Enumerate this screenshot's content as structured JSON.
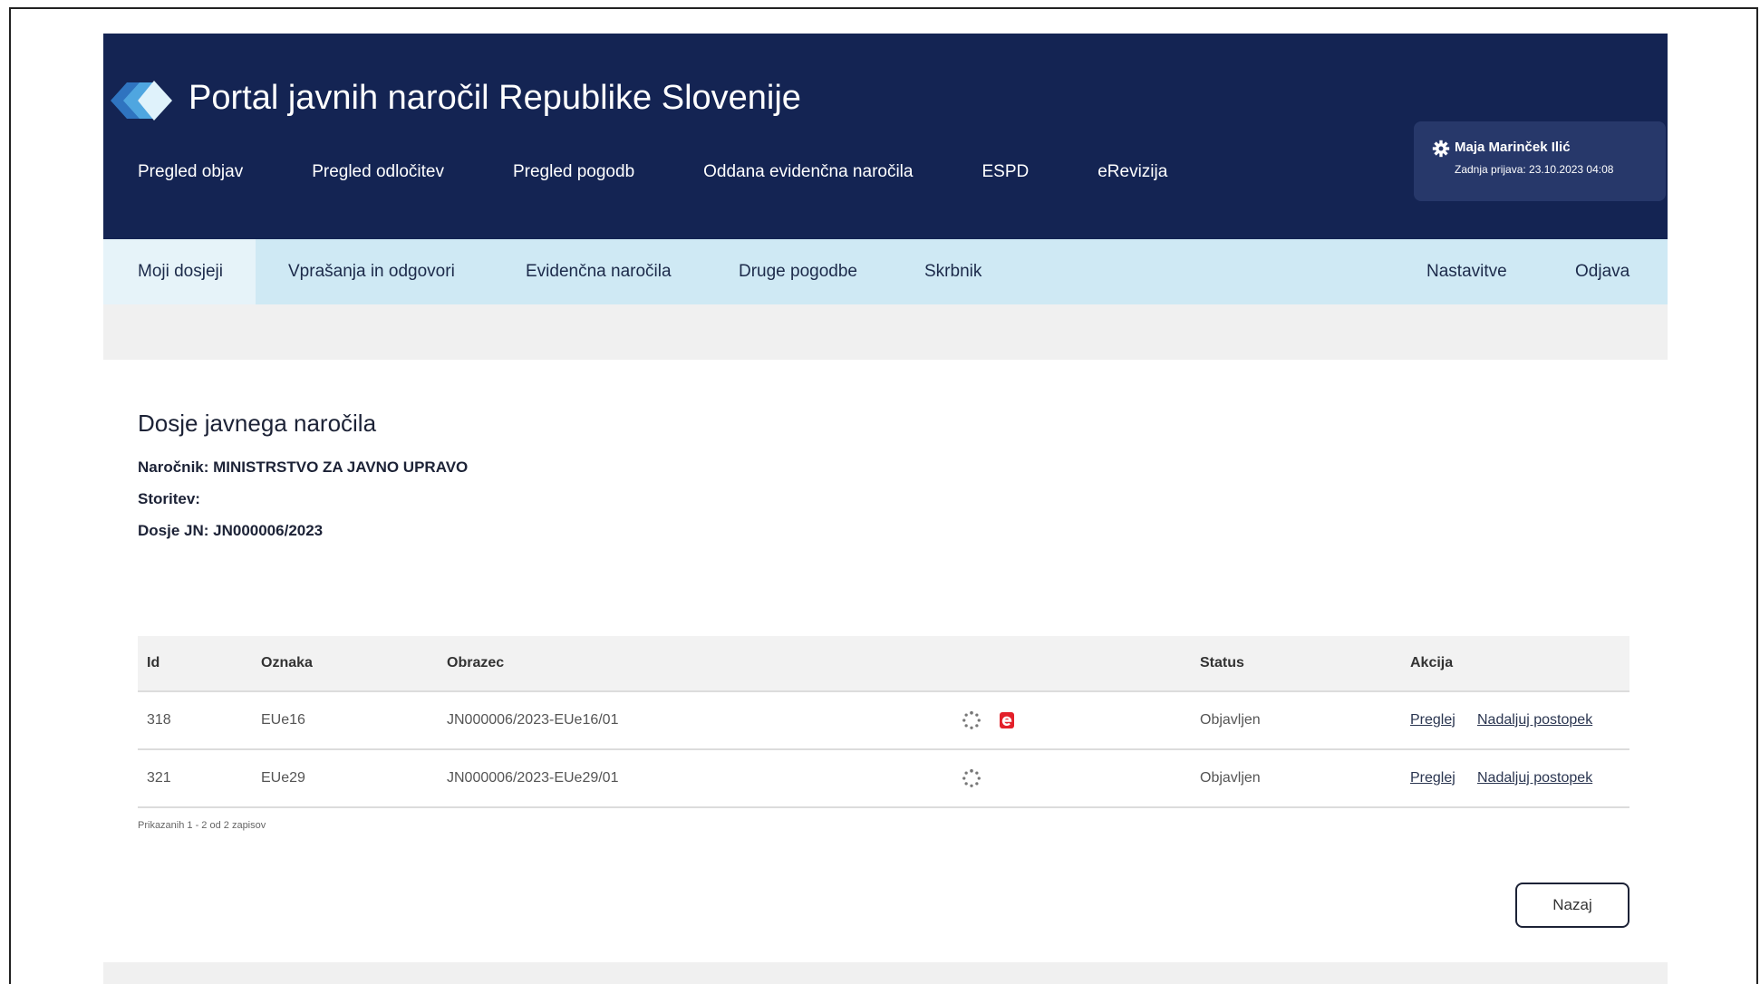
{
  "header": {
    "title": "Portal javnih naročil Republike Slovenije",
    "nav": [
      "Pregled objav",
      "Pregled odločitev",
      "Pregled pogodb",
      "Oddana evidenčna naročila",
      "ESPD",
      "eRevizija"
    ],
    "user": {
      "name": "Maja Marinček Ilić",
      "last_login": "Zadnja prijava: 23.10.2023 04:08",
      "icon": "gear-icon"
    }
  },
  "subnav": {
    "items": [
      "Moji dosjeji",
      "Vprašanja in odgovori",
      "Evidenčna naročila",
      "Druge pogodbe",
      "Skrbnik"
    ],
    "active": "Moji dosjeji",
    "right": [
      "Nastavitve",
      "Odjava"
    ]
  },
  "dossier": {
    "title": "Dosje javnega naročila",
    "narocnik": "Naročnik: MINISTRSTVO ZA JAVNO UPRAVO",
    "storitev": "Storitev:",
    "dosje": "Dosje JN: JN000006/2023"
  },
  "table": {
    "headers": {
      "id": "Id",
      "oznaka": "Oznaka",
      "obrazec": "Obrazec",
      "status": "Status",
      "akcija": "Akcija"
    },
    "rows": [
      {
        "id": "318",
        "oznaka": "EUe16",
        "obrazec": "JN000006/2023-EUe16/01",
        "status": "Objavljen",
        "view": "Preglej",
        "continue": "Nadaljuj postopek",
        "icons": [
          "spinner-icon",
          "e-icon"
        ]
      },
      {
        "id": "321",
        "oznaka": "EUe29",
        "obrazec": "JN000006/2023-EUe29/01",
        "status": "Objavljen",
        "view": "Preglej",
        "continue": "Nadaljuj postopek",
        "icons": [
          "spinner-icon"
        ]
      }
    ],
    "pager": "Prikazanih 1 - 2 od 2 zapisov"
  },
  "back_button": "Nazaj",
  "colors": {
    "header_bg": "#142453",
    "subnav_bg": "#cfe9f4",
    "accent_red": "#e3202a"
  }
}
